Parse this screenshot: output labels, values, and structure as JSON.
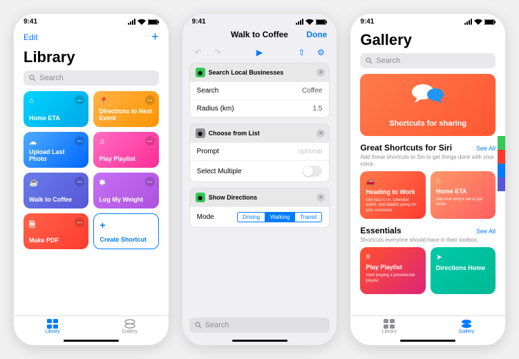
{
  "status": {
    "time": "9:41"
  },
  "library": {
    "edit": "Edit",
    "title": "Library",
    "search_placeholder": "Search",
    "tiles": [
      {
        "name": "Home ETA",
        "color": "linear-gradient(135deg,#00d4ff,#00a8e8)",
        "icon": "⌂"
      },
      {
        "name": "Directions to Next Event",
        "color": "linear-gradient(135deg,#ffb347,#ff9500)",
        "icon": "📍"
      },
      {
        "name": "Upload Last Photo",
        "color": "linear-gradient(135deg,#4facfe,#0066ff)",
        "icon": "☁"
      },
      {
        "name": "Play Playlist",
        "color": "linear-gradient(135deg,#ff6ec4,#ff2d95)",
        "icon": "♫"
      },
      {
        "name": "Walk to Coffee",
        "color": "linear-gradient(135deg,#667eea,#5856d6)",
        "icon": "☕"
      },
      {
        "name": "Log My Weight",
        "color": "linear-gradient(135deg,#c471f5,#af52de)",
        "icon": "✱"
      },
      {
        "name": "Make PDF",
        "color": "linear-gradient(135deg,#ff6347,#ff3b30)",
        "icon": "🗎"
      }
    ],
    "create": "Create Shortcut",
    "tabs": {
      "library": "Library",
      "gallery": "Gallery"
    }
  },
  "editor": {
    "title": "Walk to Coffee",
    "done": "Done",
    "actions": [
      {
        "title": "Search Local Businesses",
        "icon_bg": "#34c759",
        "rows": [
          {
            "label": "Search",
            "value": "Coffee"
          },
          {
            "label": "Radius (km)",
            "value": "1.5"
          }
        ]
      },
      {
        "title": "Choose from List",
        "icon_bg": "#8e8e93",
        "rows": [
          {
            "label": "Prompt",
            "value": "optional",
            "optional": true
          },
          {
            "label": "Select Multiple",
            "toggle": true
          }
        ]
      },
      {
        "title": "Show Directions",
        "icon_bg": "#34c759",
        "rows": [
          {
            "label": "Mode",
            "segments": [
              "Driving",
              "Walking",
              "Transit"
            ],
            "selected": 1
          }
        ]
      }
    ],
    "bottom_search_placeholder": "Search"
  },
  "gallery": {
    "title": "Gallery",
    "search_placeholder": "Search",
    "banner_title": "Shortcuts for sharing",
    "sections": [
      {
        "title": "Great Shortcuts for Siri",
        "seeall": "See All",
        "sub": "Add these shortcuts to Siri to get things done with your voice.",
        "cards": [
          {
            "title": "Heading to Work",
            "sub": "Get your ETA, calendar event, and playlist going for your commute",
            "color": "linear-gradient(135deg,#ff7b4a,#ff3b30)",
            "icon": "🚗"
          },
          {
            "title": "Home ETA",
            "sub": "See how long it will to get home",
            "color": "linear-gradient(135deg,#ff9966,#ff5e62)",
            "icon": "⌂"
          }
        ]
      },
      {
        "title": "Essentials",
        "seeall": "See All",
        "sub": "Shortcuts everyone should have in their toolbox.",
        "cards": [
          {
            "title": "Play Playlist",
            "sub": "Start playing a preselected playlist",
            "color": "linear-gradient(135deg,#ff512f,#dd2476)",
            "icon": "≡"
          },
          {
            "title": "Directions Home",
            "sub": "",
            "color": "linear-gradient(135deg,#00c9a7,#00b894)",
            "icon": "➤"
          }
        ]
      }
    ]
  }
}
